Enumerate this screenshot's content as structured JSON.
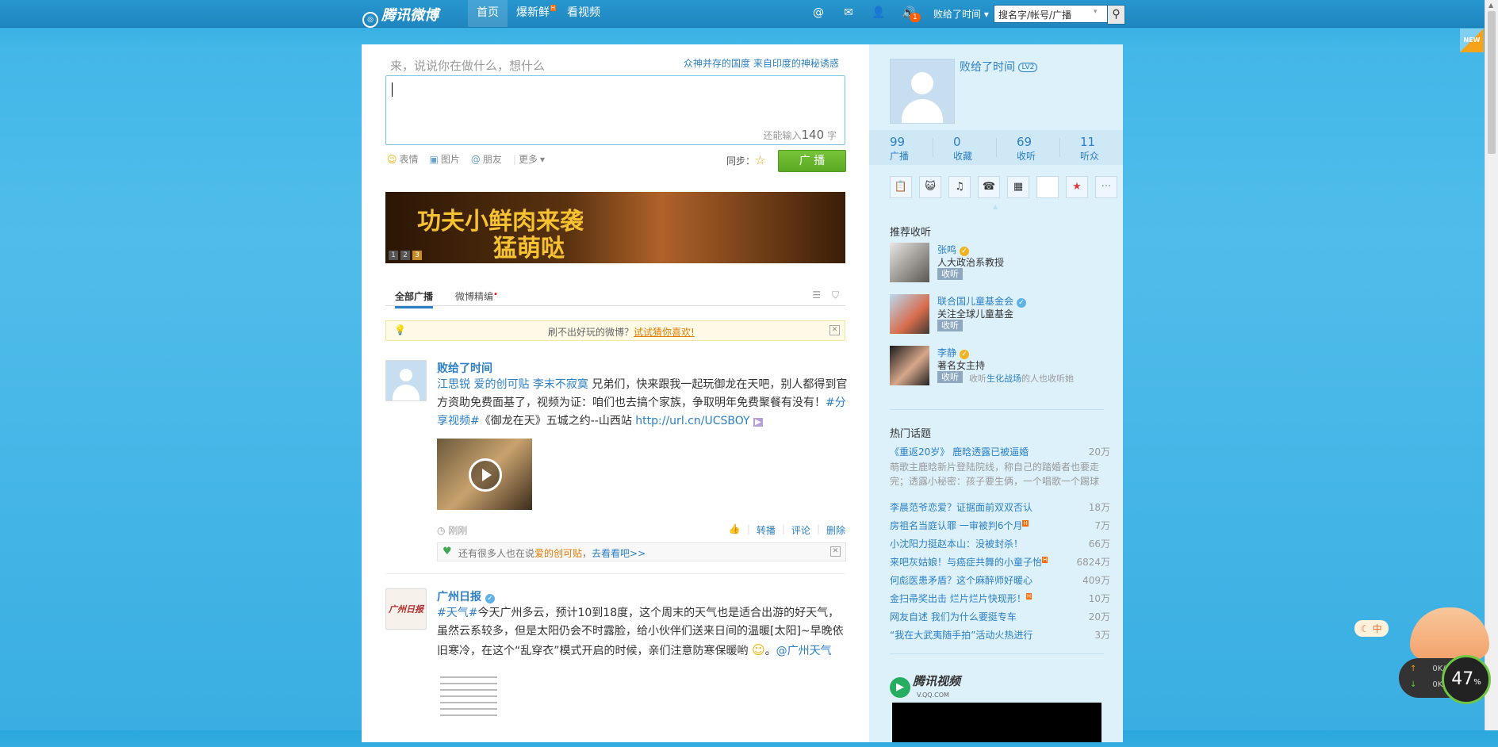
{
  "topbar": {
    "logo": "腾讯微博",
    "nav": [
      {
        "label": "首页",
        "active": true
      },
      {
        "label": "爆新鲜",
        "hot": "H"
      },
      {
        "label": "看视频"
      }
    ],
    "icons": [
      "at-icon",
      "mail-icon",
      "person-icon",
      "speaker-icon"
    ],
    "speaker_badge": "1",
    "user_menu": "败给了时间",
    "search_placeholder": "搜名字/帐号/广播"
  },
  "composer": {
    "hint": "来，说说你在做什么，想什么",
    "promo": "众神并存的国度 来自印度的神秘诱惑",
    "count_prefix": "还能输入",
    "count_value": "140",
    "count_suffix": "字",
    "tools": [
      "表情",
      "图片",
      "朋友",
      "更多"
    ],
    "sync_label": "同步：",
    "post_button": "广 播"
  },
  "banner": {
    "line1": "功夫小鲜肉来袭",
    "line2": "猛萌哒",
    "pages": [
      "1",
      "2",
      "3"
    ]
  },
  "tabs": {
    "all": "全部广播",
    "picks": "微博精编"
  },
  "notice": {
    "text": "刷不出好玩的微博？",
    "link": "试试猜你喜欢!"
  },
  "posts": [
    {
      "author": "败给了时间",
      "links": [
        "江思锐",
        "爱的创可贴",
        "李末不寂寞"
      ],
      "text1": "兄弟们，快来跟我一起玩御龙在天吧，别人都得到官方资助免费面基了，视频为证：咱们也去搞个家族，争取明年免费聚餐有没有！",
      "hashtag": "#分享视频#",
      "text2": "《御龙在天》五城之约--山西站",
      "url": "http://url.cn/UCSBOY",
      "time": "刚刚",
      "actions": [
        "转播",
        "评论",
        "删除"
      ],
      "related_text": "还有很多人也在说",
      "related_topic": "爱的创可贴",
      "related_link": "去看看吧>>"
    },
    {
      "author": "广州日报",
      "hashtag": "#天气#",
      "text": "今天广州多云，预计10到18度，这个周末的天气也是适合出游的好天气，虽然云系较多，但是太阳仍会不时露脸，给小伙伴们送来日间的温暖[太阳]~早晚依旧寒冷，在这个“乱穿衣”模式开启的时候，亲们注意防寒保暖哟",
      "mention": "@广州天气",
      "avatar_text": "广州日报"
    }
  ],
  "side": {
    "username": "败给了时间",
    "level": "LV2",
    "stats": [
      {
        "n": "99",
        "l": "广播"
      },
      {
        "n": "0",
        "l": "收藏"
      },
      {
        "n": "69",
        "l": "收听"
      },
      {
        "n": "11",
        "l": "听众"
      }
    ],
    "recommend_title": "推荐收听",
    "recommend": [
      {
        "name": "张鸣",
        "desc": "人大政治系教授",
        "follow": "收听"
      },
      {
        "name": "联合国儿童基金会",
        "desc": "关注全球儿童基金",
        "follow": "收听"
      },
      {
        "name": "李静",
        "desc": "著名女主持",
        "follow": "收听",
        "extra_prefix": "收听",
        "extra_link": "生化战场",
        "extra_suffix": "的人也收听她"
      }
    ],
    "hot_title": "热门话题",
    "hot_first": {
      "title": "《重返20岁》 鹿晗透露已被逼婚",
      "count": "20万",
      "desc": "萌歌主鹿晗新片登陆院线，称自己的踏婚者也要走完；透露小秘密：孩子要生俩，一个唱歌一个踢球"
    },
    "hot": [
      {
        "title": "李晨范爷恋爱？证据面前双双否认",
        "count": "18万"
      },
      {
        "title": "房祖名当庭认罪 一审被判6个月",
        "count": "7万",
        "hot": "H"
      },
      {
        "title": "小沈阳力挺赵本山：没被封杀！",
        "count": "66万"
      },
      {
        "title": "来吧灰姑娘！与癌症共舞的小童子怡",
        "count": "6824万",
        "hot": "H"
      },
      {
        "title": "何彪医患矛盾？这个麻醉师好暖心",
        "count": "409万"
      },
      {
        "title": "金扫帚奖出击 烂片烂片快现形！",
        "count": "10万",
        "hot": "H"
      },
      {
        "title": "网友自述 我们为什么要挺专车",
        "count": "20万"
      },
      {
        "title": "“我在大武夷随手拍”活动火热进行",
        "count": "3万"
      }
    ],
    "video_brand": "腾讯视频",
    "video_url": "V.QQ.COM"
  },
  "widgets": {
    "new_tag": "NEW",
    "cat_tag": "中",
    "speed_up": "0K/s",
    "speed_down": "0K/s",
    "gauge": "47"
  }
}
